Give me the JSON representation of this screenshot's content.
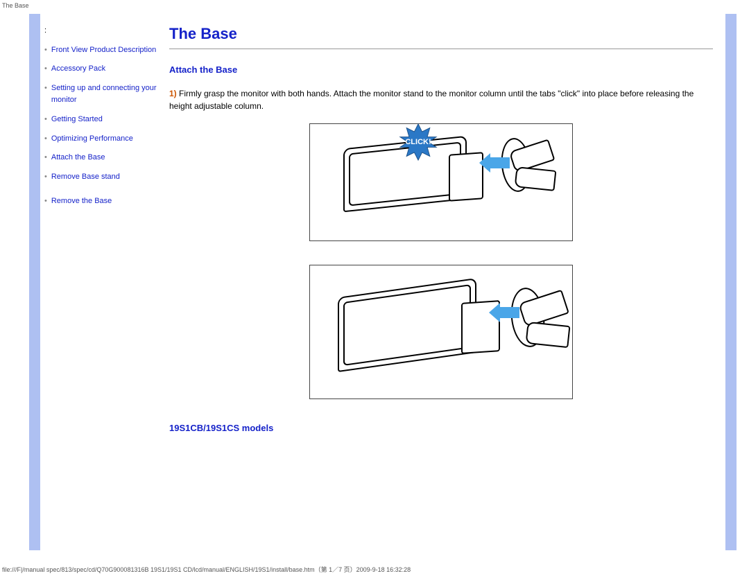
{
  "header_label": "The Base",
  "sidebar": {
    "items": [
      {
        "label": "Front View Product Description"
      },
      {
        "label": "Accessory Pack"
      },
      {
        "label": "Setting up and connecting your monitor"
      },
      {
        "label": "Getting Started"
      },
      {
        "label": "Optimizing Performance"
      },
      {
        "label": "Attach the Base"
      },
      {
        "label": "Remove Base stand"
      },
      {
        "label": "Remove the Base"
      }
    ]
  },
  "main": {
    "title": "The Base",
    "section1_title": "Attach the Base",
    "step1_num": "1)",
    "step1_text": "Firmly grasp the monitor with both hands. Attach the monitor stand to the monitor column until the tabs \"click\" into place before releasing the height adjustable column.",
    "click_label": "CLICK!",
    "models_title": "19S1CB/19S1CS models"
  },
  "footer": "file:///F|/manual spec/813/spec/cd/Q70G900081316B 19S1/19S1 CD/lcd/manual/ENGLISH/19S1/install/base.htm（第 1／7 页）2009-9-18 16:32:28"
}
